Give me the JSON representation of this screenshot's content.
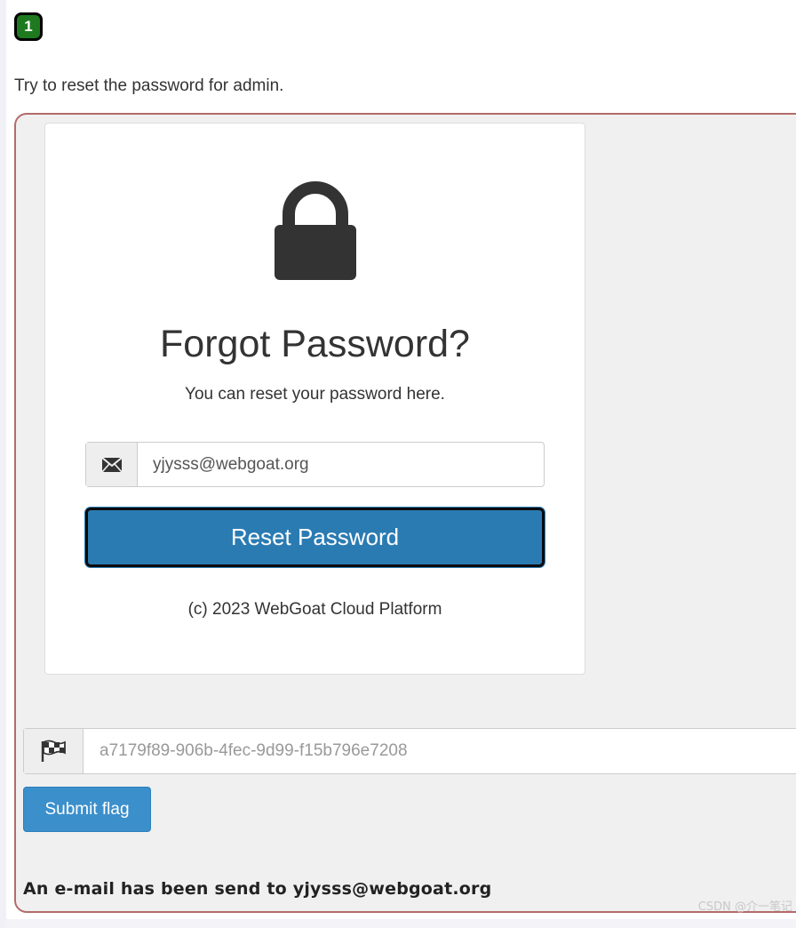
{
  "lesson": {
    "step_number": "1",
    "instruction": "Try to reset the password for admin."
  },
  "form": {
    "lock_icon": "lock-icon",
    "title": "Forgot Password?",
    "subtitle": "You can reset your password here.",
    "email_icon": "envelope-icon",
    "email_value": "yjysss@webgoat.org",
    "reset_button_label": "Reset Password",
    "copyright": "(c) 2023 WebGoat Cloud Platform"
  },
  "flag": {
    "flag_icon": "checkered-flag-icon",
    "placeholder": "a7179f89-906b-4fec-9d99-f15b796e7208",
    "submit_label": "Submit flag"
  },
  "feedback": {
    "message": "An e-mail has been send to yjysss@webgoat.org"
  },
  "watermark": "CSDN @介一笔记",
  "colors": {
    "badge": "#1f7a1f",
    "reset_button": "#2b7bb3",
    "submit_button": "#3b8fcb",
    "assignment_border": "#b36b6b"
  }
}
